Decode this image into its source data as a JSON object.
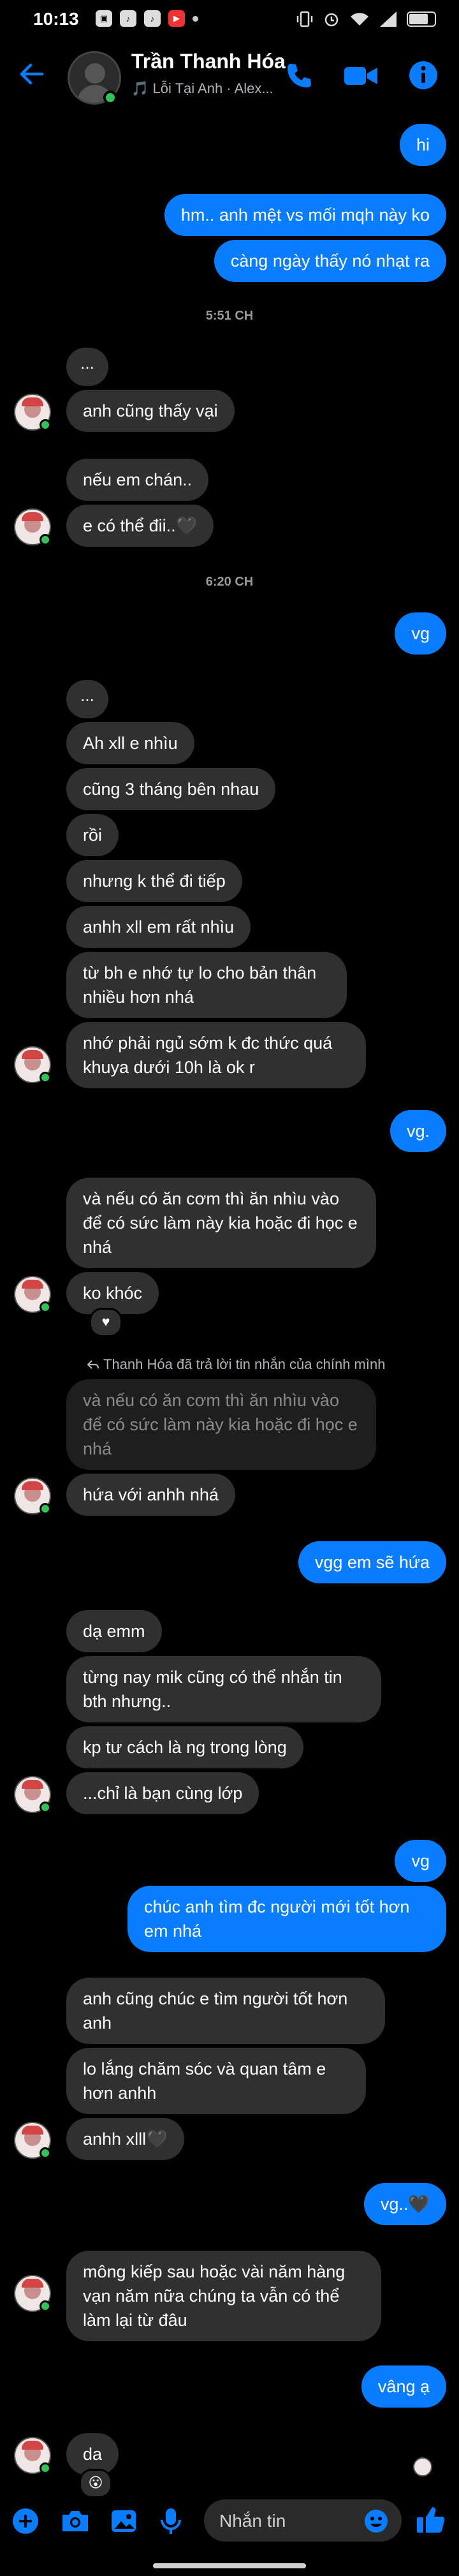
{
  "status_bar": {
    "time": "10:13",
    "battery_level": 0.75
  },
  "header": {
    "name": "Trần Thanh Hóa",
    "subtitle": "🎵 Lỗi Tại Anh · Alex...",
    "icons": [
      "back-arrow-icon",
      "phone-icon",
      "video-camera-icon",
      "info-icon"
    ]
  },
  "colors": {
    "outgoing": "#0a7cff",
    "incoming": "#303030",
    "online": "#31c35a",
    "background": "#000000"
  },
  "messages": [
    {
      "type": "out",
      "text": "hi"
    },
    {
      "type": "out",
      "text": "hm.. anh mệt vs mối mqh này ko"
    },
    {
      "type": "out",
      "text": "càng ngày thấy nó nhạt ra"
    },
    {
      "type": "timestamp",
      "text": "5:51 CH"
    },
    {
      "type": "in",
      "text": "..."
    },
    {
      "type": "in",
      "text": "anh cũng thấy vại"
    },
    {
      "type": "in",
      "text": "nếu em chán.."
    },
    {
      "type": "in",
      "text": "e có thể đii..🖤"
    },
    {
      "type": "timestamp",
      "text": "6:20 CH"
    },
    {
      "type": "out",
      "text": "vg"
    },
    {
      "type": "in",
      "text": "..."
    },
    {
      "type": "in",
      "text": "Ah xll e nhìu"
    },
    {
      "type": "in",
      "text": "cũng 3 tháng bên nhau"
    },
    {
      "type": "in",
      "text": "rồi"
    },
    {
      "type": "in",
      "text": "nhưng k thể đi tiếp"
    },
    {
      "type": "in",
      "text": "anhh xll em rất nhìu"
    },
    {
      "type": "in",
      "text": "từ bh e nhớ tự lo cho bản thân nhiều hơn nhá"
    },
    {
      "type": "in",
      "text": "nhớ phải ngủ sớm k đc thức quá khuya dưới 10h là ok r"
    },
    {
      "type": "out",
      "text": "vg."
    },
    {
      "type": "in",
      "text": "và nếu có ăn cơm thì ăn nhìu vào để có sức làm này kia hoặc đi học e nhá"
    },
    {
      "type": "in",
      "text": "ko khóc",
      "reaction": "♥"
    },
    {
      "type": "reply_label",
      "text": "Thanh Hóa đã trả lời tin nhắn của chính mình"
    },
    {
      "type": "quoted",
      "text": "và nếu có ăn cơm thì ăn nhìu vào để có sức làm này kia hoặc đi học e nhá"
    },
    {
      "type": "in",
      "text": "hứa với anhh nhá"
    },
    {
      "type": "out",
      "text": "vgg em sẽ hứa"
    },
    {
      "type": "in",
      "text": "dạ emm"
    },
    {
      "type": "in",
      "text": "từng nay mik cũng có thể nhắn tin bth nhưng.."
    },
    {
      "type": "in",
      "text": "kp tư cách là ng trong lòng"
    },
    {
      "type": "in",
      "text": "...chỉ là bạn cùng lớp"
    },
    {
      "type": "out",
      "text": "vg"
    },
    {
      "type": "out",
      "text": "chúc anh tìm đc người mới tốt hơn em nhá"
    },
    {
      "type": "in",
      "text": "anh cũng chúc e tìm người tốt hơn anh"
    },
    {
      "type": "in",
      "text": "lo lắng chăm sóc và quan tâm e hơn anhh"
    },
    {
      "type": "in",
      "text": "anhh xlll🖤"
    },
    {
      "type": "out",
      "text": "vg..🖤"
    },
    {
      "type": "in",
      "text": "mông kiếp sau hoặc vài năm hàng vạn năm nữa chúng ta vẫn có thể làm lại từ đâu"
    },
    {
      "type": "out",
      "text": "vâng ạ"
    },
    {
      "type": "in",
      "text": "da",
      "reaction": "😮"
    }
  ],
  "composer": {
    "placeholder": "Nhắn tin",
    "icons": [
      "plus-circle-icon",
      "camera-icon",
      "gallery-icon",
      "microphone-icon",
      "emoji-icon",
      "thumbs-up-icon"
    ]
  }
}
